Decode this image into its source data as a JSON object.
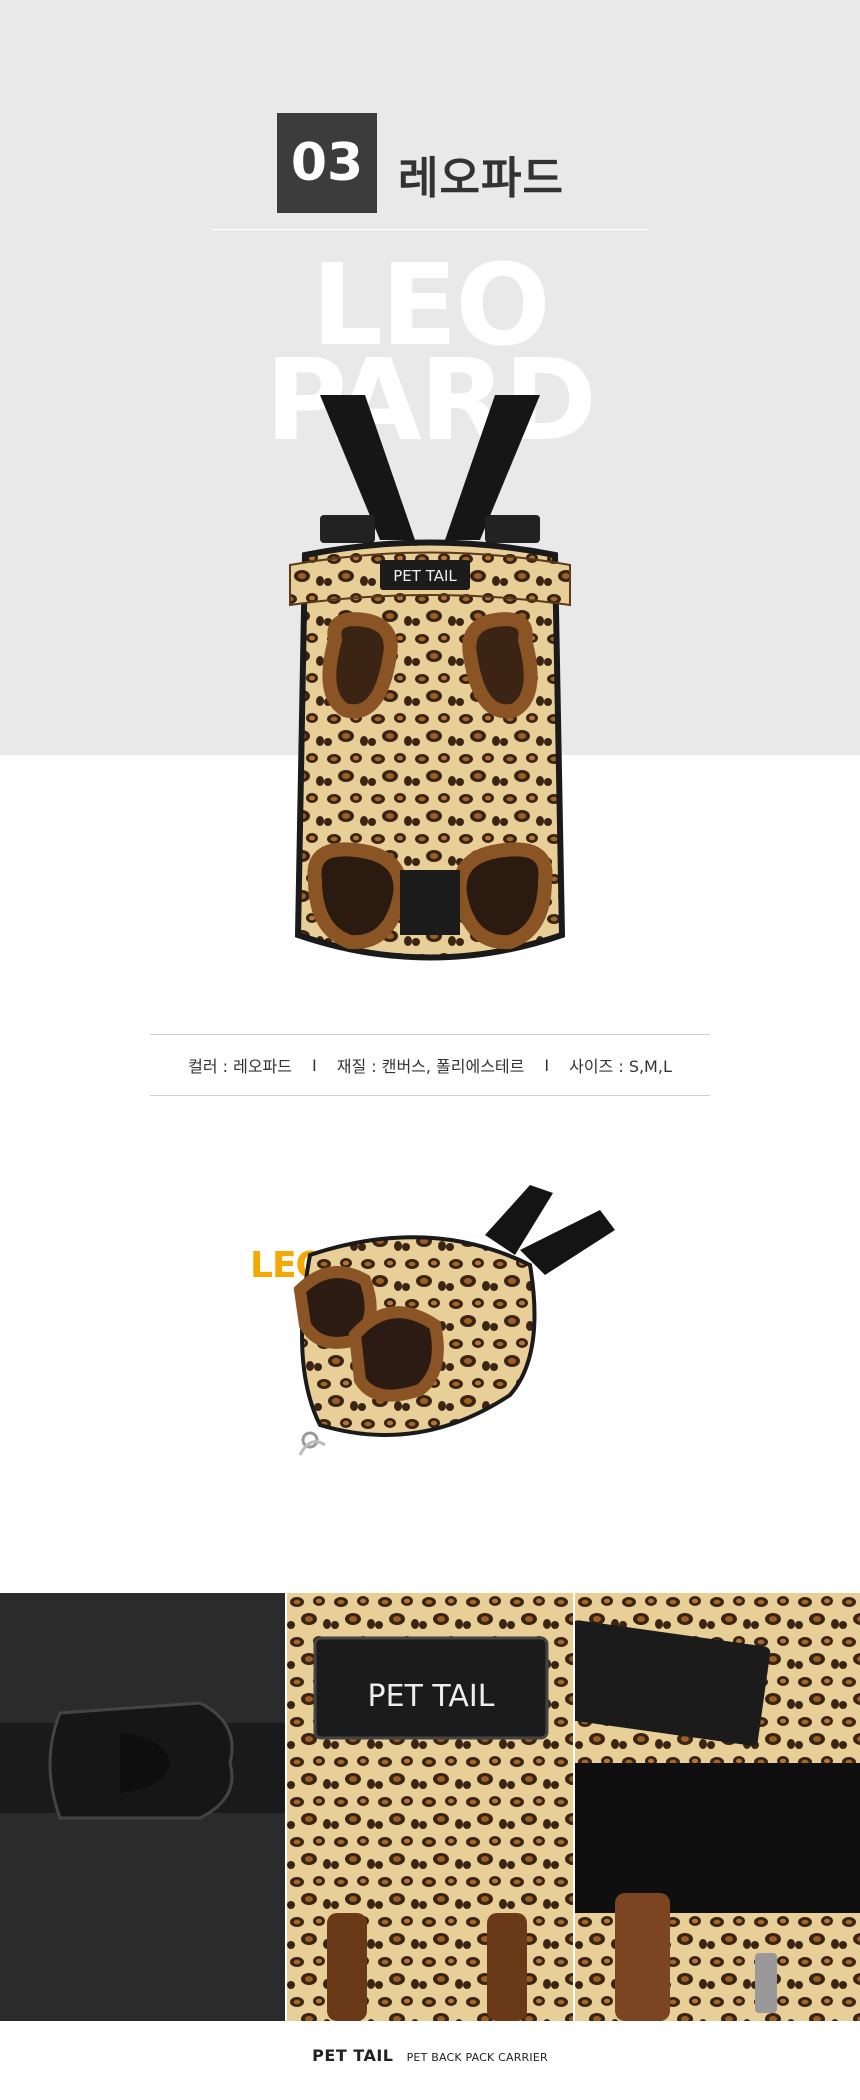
{
  "header": {
    "number": "03",
    "color_name": "레오파드",
    "big_word_line1": "LEO",
    "big_word_line2": "PARD"
  },
  "product": {
    "badge_text": "PET TAIL"
  },
  "specs": {
    "color": "컬러 : 레오파드",
    "separator": "I",
    "material": "재질 : 캔버스, 폴리에스테르",
    "size": "사이즈 : S,M,L"
  },
  "side_view": {
    "label": "LEOPARD",
    "label_color": "#f5a800"
  },
  "details": {
    "badge_text": "PET TAIL"
  },
  "footer": {
    "brand": "PET TAIL",
    "subtitle": "PET BACK PACK CARRIER"
  }
}
